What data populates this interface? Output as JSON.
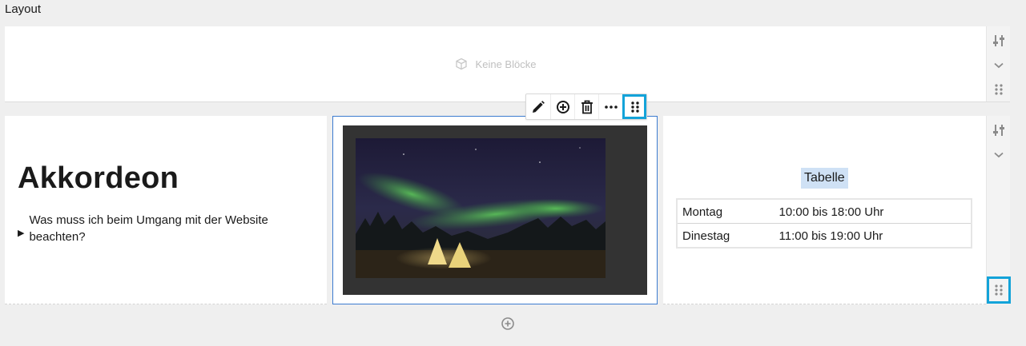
{
  "page": {
    "title": "Layout"
  },
  "section1": {
    "empty_text": "Keine Blöcke",
    "rail": [
      "settings-sliders-icon",
      "chevron-down-icon",
      "drag-handle-icon"
    ]
  },
  "section2": {
    "column1": {
      "heading": "Akkordeon",
      "accordion_label": "Was muss ich beim Umgang mit der Website beachten?"
    },
    "column3": {
      "table_caption": "Tabelle",
      "rows": [
        {
          "day": "Montag",
          "hours": "10:00 bis 18:00 Uhr"
        },
        {
          "day": "Dinestag",
          "hours": "11:00 bis 19:00 Uhr"
        }
      ]
    },
    "rail": [
      "settings-sliders-icon",
      "chevron-down-icon",
      "drag-handle-icon"
    ]
  },
  "block_toolbar": {
    "buttons": [
      "edit-icon",
      "add-icon",
      "delete-icon",
      "more-icon",
      "drag-handle-icon"
    ]
  },
  "colors": {
    "selection": "#3c7bd0",
    "highlight": "#13a3d9",
    "caption_bg": "#cfe1f5"
  }
}
